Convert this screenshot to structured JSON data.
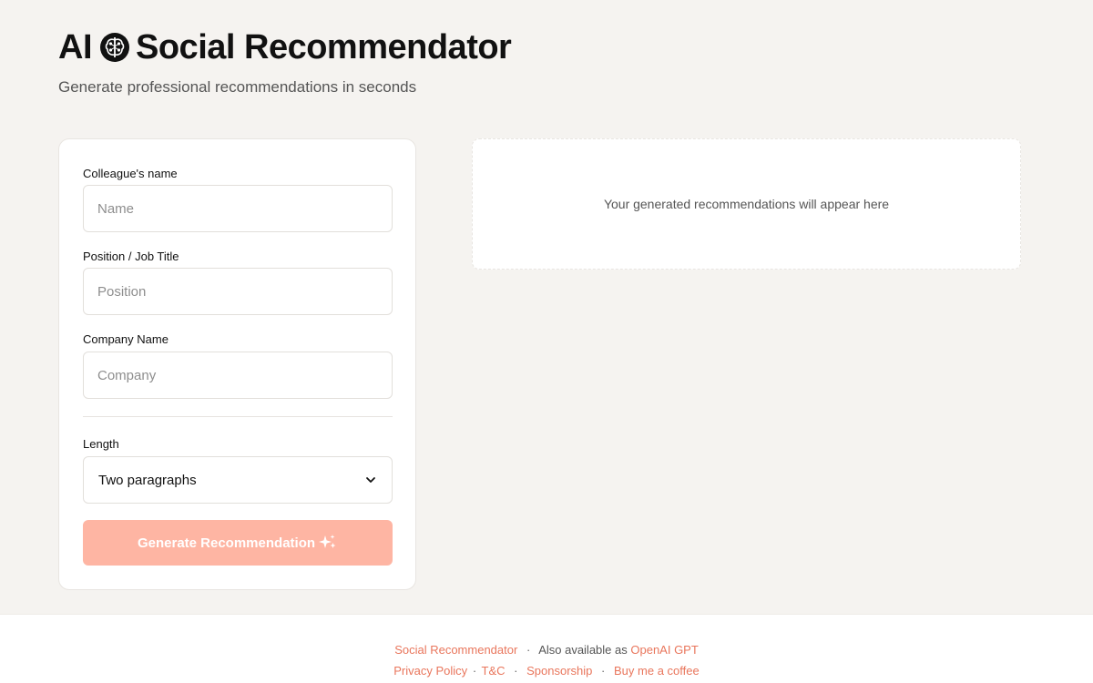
{
  "header": {
    "title_prefix": "AI",
    "title_main": "Social Recommendator",
    "subtitle": "Generate professional recommendations in seconds",
    "icon": "brain-icon"
  },
  "form": {
    "name_label": "Colleague's name",
    "name_placeholder": "Name",
    "name_value": "",
    "position_label": "Position / Job Title",
    "position_placeholder": "Position",
    "position_value": "",
    "company_label": "Company Name",
    "company_placeholder": "Company",
    "company_value": "",
    "length_label": "Length",
    "length_selected": "Two paragraphs",
    "generate_label": "Generate Recommendation"
  },
  "output": {
    "placeholder": "Your generated recommendations will appear here"
  },
  "footer": {
    "brand_link": "Social Recommendator",
    "sep1": "·",
    "also_text": "Also available as",
    "gpt_link": "OpenAI GPT",
    "privacy_link": "Privacy Policy",
    "sep2": "·",
    "tc_link": "T&C",
    "sep3": "·",
    "sponsorship_link": "Sponsorship",
    "sep4": "·",
    "coffee_link": "Buy me a coffee"
  },
  "colors": {
    "background": "#f5f3f0",
    "accent": "#e9765c",
    "button_disabled": "#feb5a3",
    "text": "#111111"
  }
}
